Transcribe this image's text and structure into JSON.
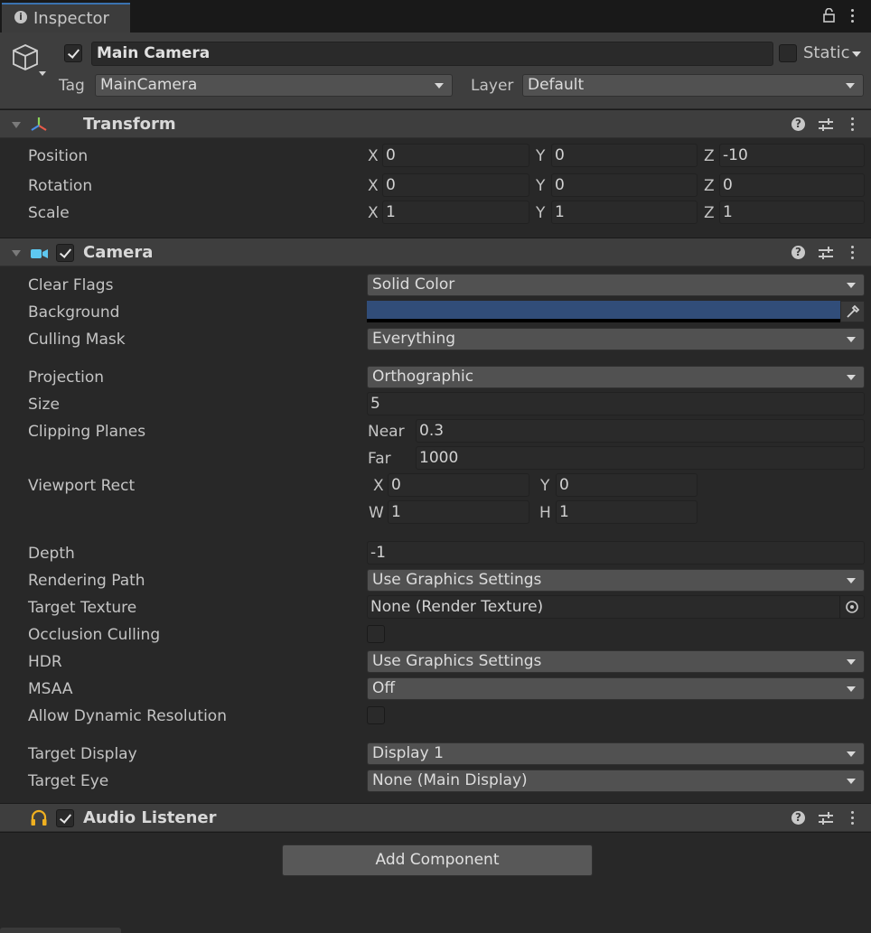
{
  "tab": {
    "title": "Inspector"
  },
  "gameobject": {
    "name": "Main Camera",
    "active": true,
    "static_label": "Static",
    "tag_label": "Tag",
    "tag_value": "MainCamera",
    "layer_label": "Layer",
    "layer_value": "Default"
  },
  "transform": {
    "title": "Transform",
    "rows": [
      {
        "label": "Position",
        "x": "0",
        "y": "0",
        "z": "-10"
      },
      {
        "label": "Rotation",
        "x": "0",
        "y": "0",
        "z": "0"
      },
      {
        "label": "Scale",
        "x": "1",
        "y": "1",
        "z": "1"
      }
    ]
  },
  "camera": {
    "title": "Camera",
    "enabled": true,
    "clear_flags": {
      "label": "Clear Flags",
      "value": "Solid Color"
    },
    "background": {
      "label": "Background",
      "color": "#314d79"
    },
    "culling_mask": {
      "label": "Culling Mask",
      "value": "Everything"
    },
    "projection": {
      "label": "Projection",
      "value": "Orthographic"
    },
    "size": {
      "label": "Size",
      "value": "5"
    },
    "clipping": {
      "label": "Clipping Planes",
      "near_label": "Near",
      "near": "0.3",
      "far_label": "Far",
      "far": "1000"
    },
    "viewport": {
      "label": "Viewport Rect",
      "x": "0",
      "y": "0",
      "w": "1",
      "h": "1"
    },
    "depth": {
      "label": "Depth",
      "value": "-1"
    },
    "rendering_path": {
      "label": "Rendering Path",
      "value": "Use Graphics Settings"
    },
    "target_texture": {
      "label": "Target Texture",
      "value": "None (Render Texture)"
    },
    "occlusion_culling": {
      "label": "Occlusion Culling",
      "checked": false
    },
    "hdr": {
      "label": "HDR",
      "value": "Use Graphics Settings"
    },
    "msaa": {
      "label": "MSAA",
      "value": "Off"
    },
    "dynamic_resolution": {
      "label": "Allow Dynamic Resolution",
      "checked": false
    },
    "target_display": {
      "label": "Target Display",
      "value": "Display 1"
    },
    "target_eye": {
      "label": "Target Eye",
      "value": "None (Main Display)"
    }
  },
  "audio_listener": {
    "title": "Audio Listener",
    "enabled": true
  },
  "add_component": {
    "label": "Add Component"
  },
  "axes": {
    "x": "X",
    "y": "Y",
    "z": "Z",
    "w": "W",
    "h": "H"
  },
  "colors": {
    "panel_bg": "#282828",
    "header_bg": "#3e3e3e",
    "field_bg": "#2a2a2a",
    "dropdown_bg": "#515151",
    "camera_icon": "#5ec8f0",
    "audio_icon": "#f0b020"
  },
  "icons": {
    "tab": "info-icon",
    "gameobject": "cube-icon",
    "transform": "transform-axes-icon",
    "camera": "camera-icon",
    "audio": "headphones-icon",
    "help": "help-icon",
    "presets": "sliders-icon",
    "menu": "kebab-menu-icon",
    "lock": "lock-icon",
    "eyedropper": "eyedropper-icon",
    "object_picker": "object-picker-icon"
  }
}
